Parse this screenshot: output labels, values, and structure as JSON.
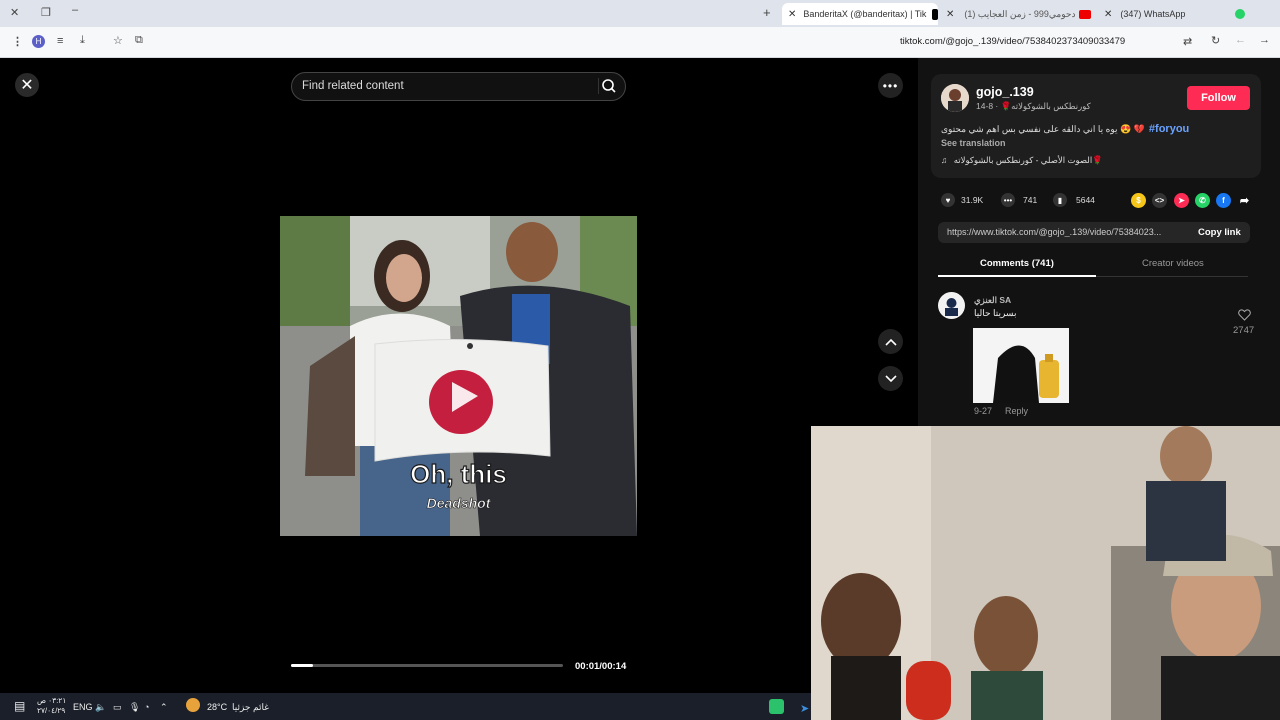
{
  "browser": {
    "tabs": [
      {
        "label": "BanderitaX (@banderitax) | Tik",
        "active": true
      },
      {
        "label": "(1) دحومي999 - زمن العجايب",
        "active": false
      },
      {
        "label": "(347) WhatsApp",
        "active": false
      }
    ],
    "url": "tiktok.com/@gojo_.139/video/7538402373409033479"
  },
  "search": {
    "placeholder": "Find related content"
  },
  "video": {
    "caption_main": "Oh, this",
    "caption_sub": "Deadshot",
    "time": "00:01/00:14",
    "progress": 0.08
  },
  "author": {
    "username": "gojo_.139",
    "subline": "كورنطكس بالشوكولاته🌹 · 8-14",
    "follow_label": "Follow",
    "caption": "يوه يا اني دالقه على نفسي بس اهم شي محتوى 😍 💔",
    "hashtag": "#foryou",
    "see_translation": "See translation",
    "music": "الصوت الأصلي - كورنطكس بالشوكولاته🌹"
  },
  "stats": {
    "likes": "31.9K",
    "comments": "741",
    "saves": "5644"
  },
  "share": {
    "link": "https://www.tiktok.com/@gojo_.139/video/75384023...",
    "copy_label": "Copy link"
  },
  "tabs": {
    "comments": "Comments (741)",
    "creator": "Creator videos"
  },
  "comment": {
    "author": "العنزي SA",
    "text": "بسريتا حاليا",
    "date": "9-27",
    "reply": "Reply",
    "likes": "2747"
  },
  "taskbar": {
    "weather": "28°C",
    "weather_label": "غائم جزئيا",
    "lang": "ENG",
    "time": "٠٣:٢١ ص",
    "date": "٢٧/٠٤/٢٩"
  },
  "colors": {
    "follow": "#fe2c55",
    "hashtag": "#6aa2ff"
  }
}
